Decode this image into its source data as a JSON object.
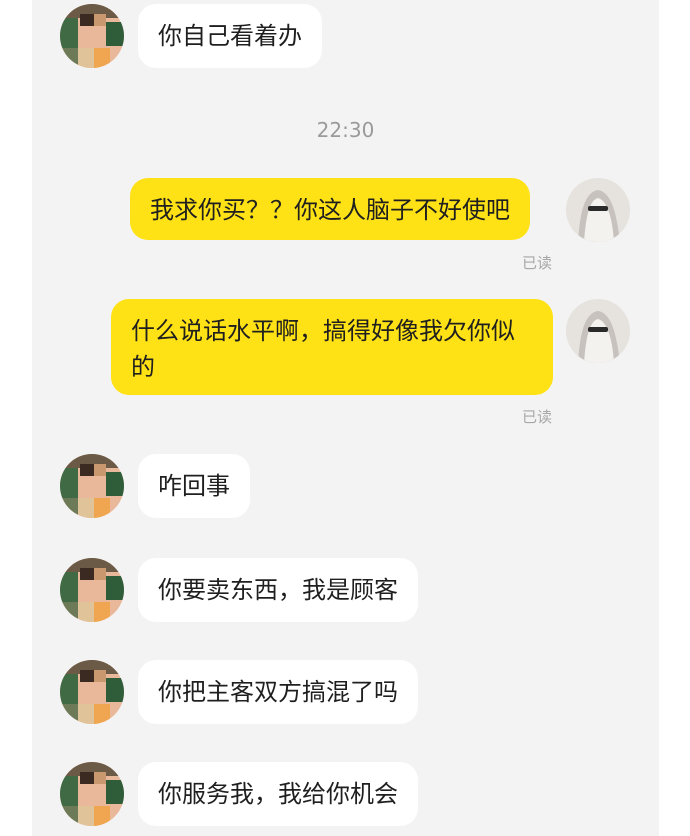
{
  "timestamp": "22:30",
  "messages": [
    {
      "side": "in",
      "text": "你自己看着办"
    },
    {
      "side": "out",
      "text": "我求你买？？你这人脑子不好使吧",
      "status": "已读"
    },
    {
      "side": "out",
      "text": "什么说话水平啊，搞得好像我欠你似的",
      "status": "已读"
    },
    {
      "side": "in",
      "text": "咋回事"
    },
    {
      "side": "in",
      "text": "你要卖东西，我是顾客"
    },
    {
      "side": "in",
      "text": "你把主客双方搞混了吗"
    },
    {
      "side": "in",
      "text": "你服务我，我给你机会"
    }
  ],
  "colors": {
    "background": "#f3f3f3",
    "outgoing_bubble": "#ffe216",
    "incoming_bubble": "#ffffff"
  }
}
